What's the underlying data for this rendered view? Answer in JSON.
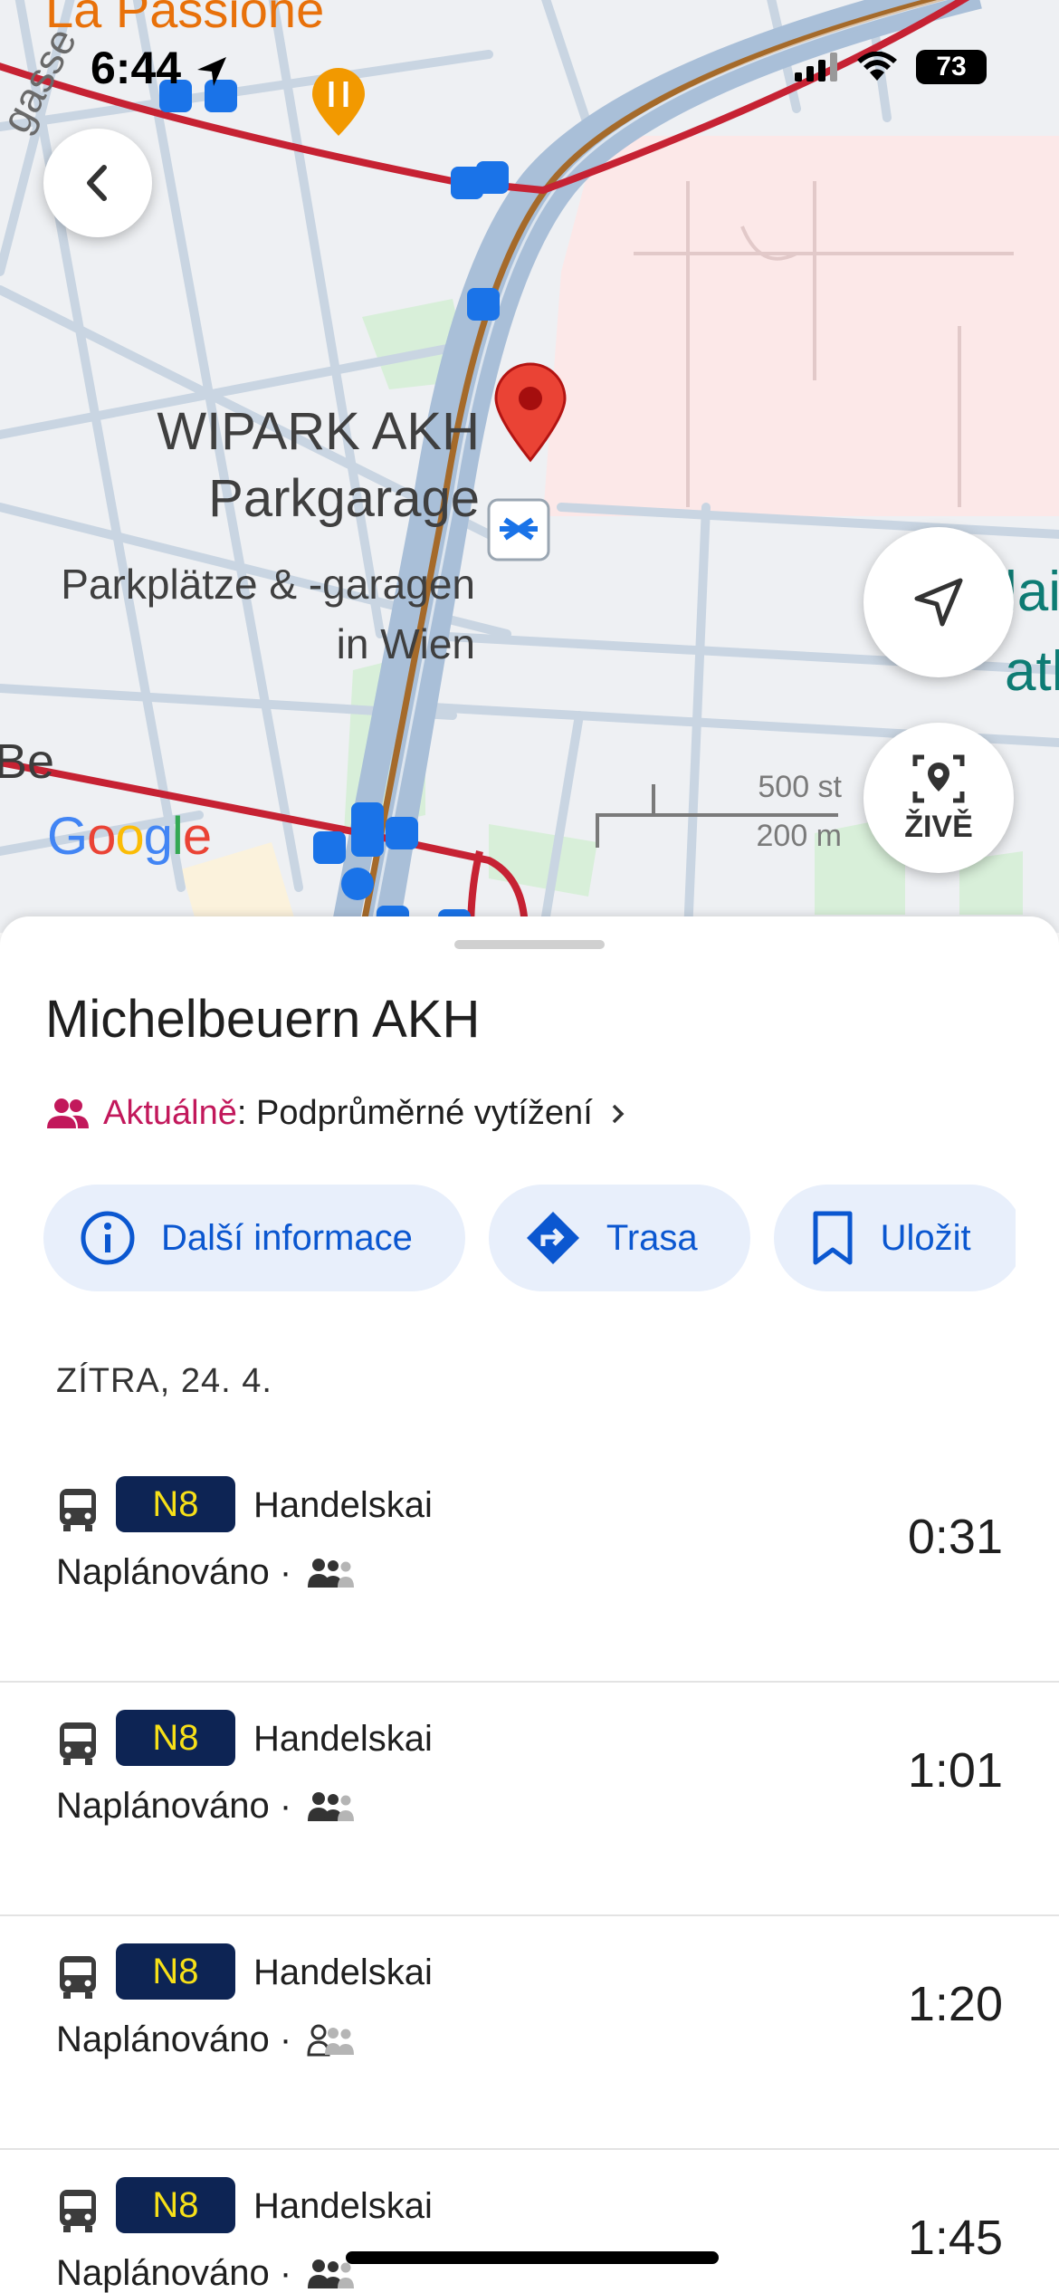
{
  "status_bar": {
    "time": "6:44",
    "battery": "73"
  },
  "map": {
    "labels": {
      "restaurant": "La Passione",
      "garage_name_line1": "WIPARK AKH",
      "garage_name_line2": "Parkgarage",
      "garage_category_line1": "Parkplätze & -garagen",
      "garage_category_line2": "in Wien",
      "street_partial": "gasse",
      "street_be": "Be",
      "teal_label_line1": "lai",
      "teal_label_line2": "ath"
    },
    "logo": [
      "G",
      "o",
      "o",
      "g",
      "l",
      "e"
    ],
    "scale": {
      "imperial": "500 st",
      "metric": "200 m"
    },
    "live_button_label": "ŽIVĚ"
  },
  "place": {
    "title": "Michelbeuern AKH",
    "crowd_label": "Aktuálně",
    "crowd_value": ": Podprůměrné vytížení"
  },
  "actions": [
    {
      "label": "Další informace",
      "icon": "info-icon"
    },
    {
      "label": "Trasa",
      "icon": "directions-icon"
    },
    {
      "label": "Uložit",
      "icon": "bookmark-icon"
    }
  ],
  "departures": {
    "date_header": "ZÍTRA, 24. 4.",
    "items": [
      {
        "line": "N8",
        "destination": "Handelskai",
        "status": "Naplánováno ·",
        "time": "0:31",
        "crowd_level": 1
      },
      {
        "line": "N8",
        "destination": "Handelskai",
        "status": "Naplánováno ·",
        "time": "1:01",
        "crowd_level": 1
      },
      {
        "line": "N8",
        "destination": "Handelskai",
        "status": "Naplánováno ·",
        "time": "1:20",
        "crowd_level": 0
      },
      {
        "line": "N8",
        "destination": "Handelskai",
        "status": "Naplánováno ·",
        "time": "1:45",
        "crowd_level": 1
      }
    ]
  },
  "colors": {
    "accent_blue": "#0b57d0",
    "chip_bg": "#e8effb",
    "line_badge_bg": "#0d2454",
    "line_badge_text": "#f7e018",
    "crowd_pink": "#c2185b",
    "pin_red": "#ea4335"
  }
}
